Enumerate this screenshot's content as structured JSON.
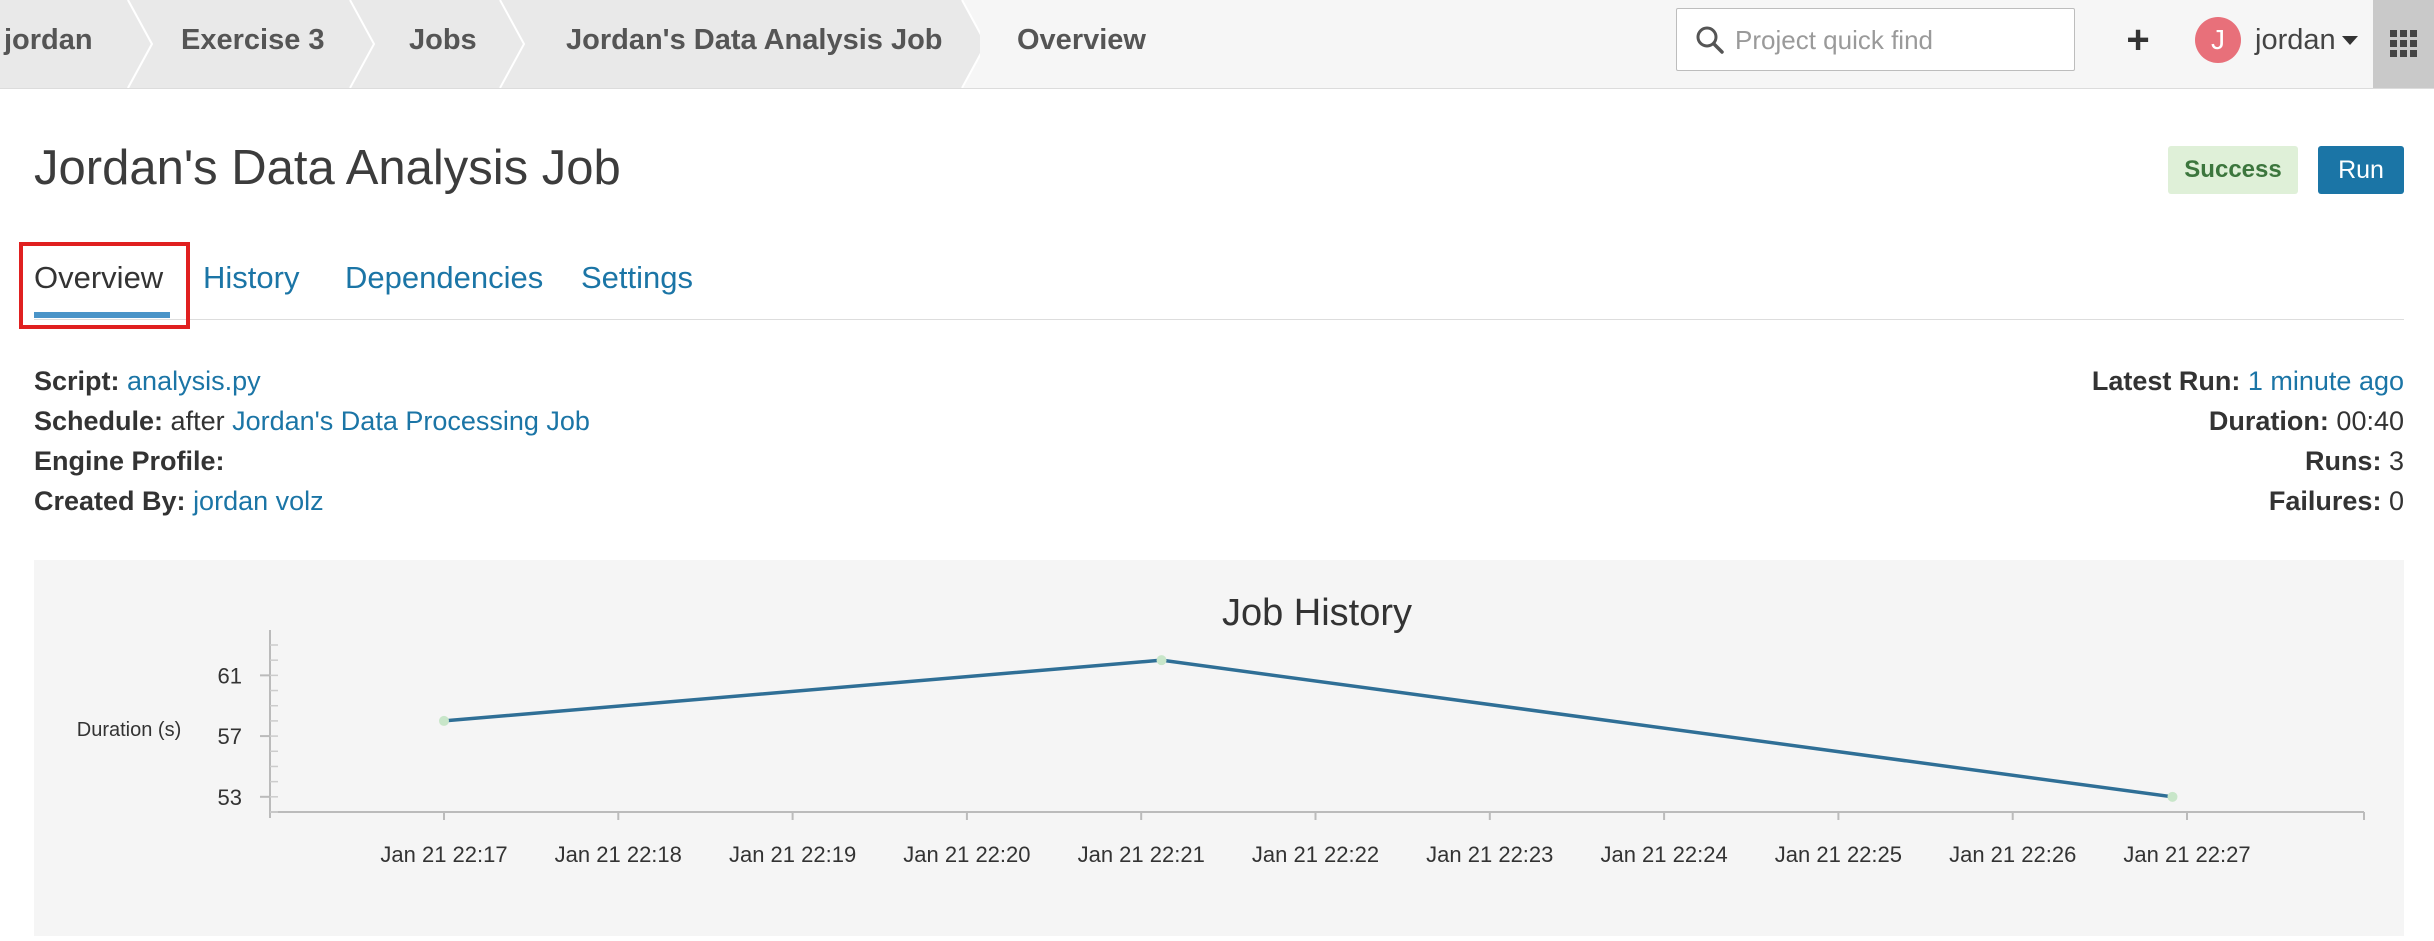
{
  "topbar": {
    "breadcrumbs": [
      "jordan",
      "Exercise 3",
      "Jobs",
      "Jordan's Data Analysis Job",
      "Overview"
    ],
    "search_placeholder": "Project quick find",
    "add_symbol": "+",
    "user": {
      "initial": "J",
      "name": "jordan"
    }
  },
  "job": {
    "title": "Jordan's Data Analysis Job",
    "status": "Success",
    "status_color": "#3c763d",
    "run_label": "Run"
  },
  "tabs": [
    "Overview",
    "History",
    "Dependencies",
    "Settings"
  ],
  "active_tab": "Overview",
  "details": {
    "script_label": "Script:",
    "script_value": "analysis.py",
    "schedule_label": "Schedule:",
    "schedule_prefix": "after",
    "schedule_value": "Jordan's Data Processing Job",
    "engine_label": "Engine Profile:",
    "created_label": "Created By:",
    "created_value": "jordan volz",
    "latest_run_label": "Latest Run:",
    "latest_run_value": "1 minute ago",
    "duration_label": "Duration:",
    "duration_value": "00:40",
    "runs_label": "Runs:",
    "runs_value": "3",
    "failures_label": "Failures:",
    "failures_value": "0"
  },
  "chart_data": {
    "type": "line",
    "title": "Job History",
    "ylabel": "Duration (s)",
    "xlabel": "",
    "x_ticks": [
      "Jan 21 22:17",
      "Jan 21 22:18",
      "Jan 21 22:19",
      "Jan 21 22:20",
      "Jan 21 22:21",
      "Jan 21 22:22",
      "Jan 21 22:23",
      "Jan 21 22:24",
      "Jan 21 22:25",
      "Jan 21 22:26",
      "Jan 21 22:27"
    ],
    "y_ticks": [
      53,
      57,
      61
    ],
    "ylim": [
      52,
      63
    ],
    "x": [
      "Jan 21 22:17",
      "Jan 21 22:21:07",
      "Jan 21 22:26:55"
    ],
    "values": [
      58,
      62,
      53
    ],
    "line_color": "#2f6f96",
    "marker_color": "#c8e6c9"
  }
}
